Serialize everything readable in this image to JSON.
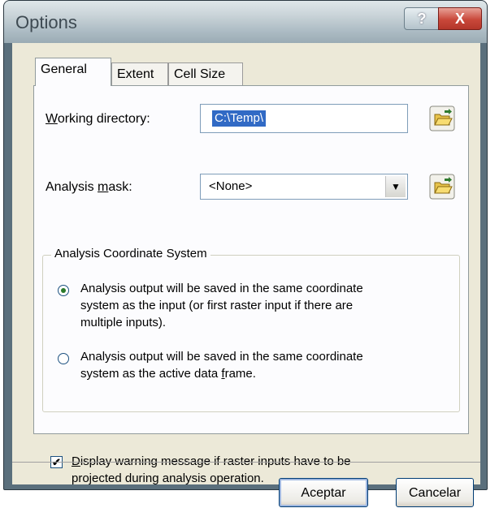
{
  "window": {
    "title": "Options",
    "help_label": "?",
    "close_label": "X"
  },
  "tabs": [
    {
      "label": "General",
      "active": true
    },
    {
      "label": "Extent",
      "active": false
    },
    {
      "label": "Cell Size",
      "active": false
    }
  ],
  "general": {
    "working_directory": {
      "label_hotkey": "W",
      "label_rest": "orking directory:",
      "value": "C:\\Temp\\"
    },
    "analysis_mask": {
      "label_prefix": "Analysis ",
      "label_hotkey": "m",
      "label_rest": "ask:",
      "value": "<None>"
    },
    "coordinate_system": {
      "title": "Analysis Coordinate System",
      "option1": {
        "line1": "Analysis output will be saved in the same coordinate",
        "line2": "system as the input (or first raster input if there are",
        "line3": "multiple inputs).",
        "selected": true
      },
      "option2": {
        "line1": "Analysis output will be saved in the same coordinate",
        "line2_prefix": "system as the active data ",
        "line2_hotkey": "f",
        "line2_rest": "rame.",
        "selected": false
      }
    },
    "warning": {
      "checked": true,
      "check_glyph": "✔",
      "line1_hotkey": "D",
      "line1_rest": "isplay warning message if raster inputs have to be",
      "line2": "projected during analysis operation."
    }
  },
  "buttons": {
    "ok": "Aceptar",
    "cancel": "Cancelar"
  },
  "icons": {
    "folder": "open-folder-icon",
    "dropdown": "chevron-down-icon"
  },
  "colors": {
    "selection": "#316ac5",
    "dialog_bg": "#ece9d8",
    "close_red": "#c9483a"
  }
}
